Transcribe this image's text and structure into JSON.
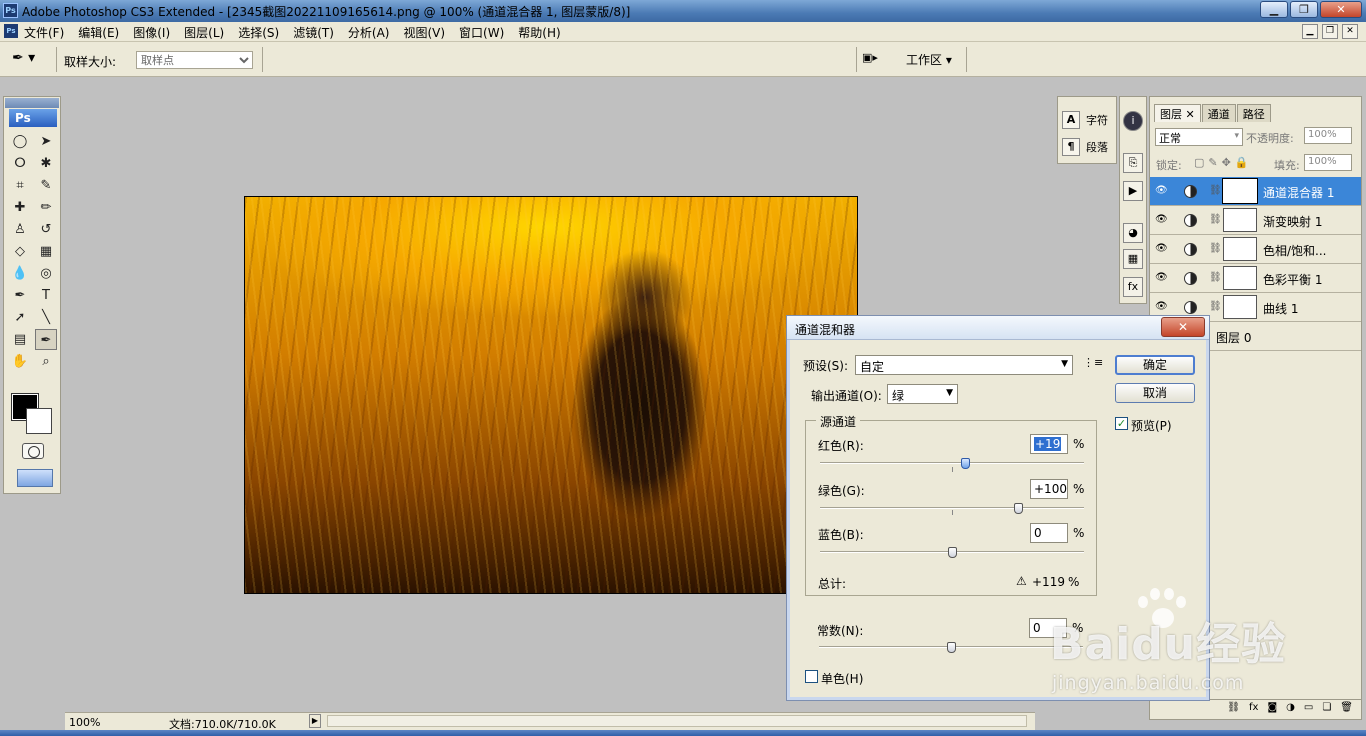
{
  "window": {
    "title": "Adobe Photoshop CS3 Extended - [2345截图20221109165614.png @ 100% (通道混合器 1, 图层蒙版/8)]",
    "app_icon": "Ps"
  },
  "menu": [
    "文件(F)",
    "编辑(E)",
    "图像(I)",
    "图层(L)",
    "选择(S)",
    "滤镜(T)",
    "分析(A)",
    "视图(V)",
    "窗口(W)",
    "帮助(H)"
  ],
  "options": {
    "sample_size_label": "取样大小:",
    "sample_size_value": "取样点",
    "workspace_label": "工作区 ▾"
  },
  "toolbox": {
    "logo": "Ps",
    "foreground_color": "#000000",
    "background_color": "#ffffff"
  },
  "status": {
    "zoom": "100%",
    "doc": "文档:710.0K/710.0K"
  },
  "char_panel": {
    "character": "字符",
    "paragraph": "段落"
  },
  "layers_panel": {
    "tabs": [
      "图层",
      "通道",
      "路径"
    ],
    "blend_mode": "正常",
    "opacity_label": "不透明度:",
    "opacity_value": "100%",
    "lock_label": "锁定:",
    "fill_label": "填充:",
    "fill_value": "100%",
    "layers": [
      {
        "name": "通道混合器 1",
        "selected": true
      },
      {
        "name": "渐变映射 1",
        "selected": false
      },
      {
        "name": "色相/饱和...",
        "selected": false
      },
      {
        "name": "色彩平衡 1",
        "selected": false
      },
      {
        "name": "曲线 1",
        "selected": false
      }
    ],
    "base_layer": "图层 0"
  },
  "dialog": {
    "title": "通道混和器",
    "preset_label": "预设(S):",
    "preset_value": "自定",
    "output_label": "输出通道(O):",
    "output_value": "绿",
    "ok": "确定",
    "cancel": "取消",
    "preview_label": "预览(P)",
    "preview_checked": true,
    "source_group": "源通道",
    "red_label": "红色(R):",
    "red_value": "+19",
    "red_percent": 19,
    "green_label": "绿色(G):",
    "green_value": "+100",
    "green_percent": 100,
    "blue_label": "蓝色(B):",
    "blue_value": "0",
    "blue_percent": 0,
    "total_label": "总计:",
    "total_value": "+119",
    "constant_label": "常数(N):",
    "constant_value": "0",
    "constant_percent": 0,
    "percent": "%",
    "mono_label": "单色(H)",
    "mono_checked": false
  },
  "watermark": {
    "brand": "Baidu经验",
    "url": "jingyan.baidu.com"
  }
}
